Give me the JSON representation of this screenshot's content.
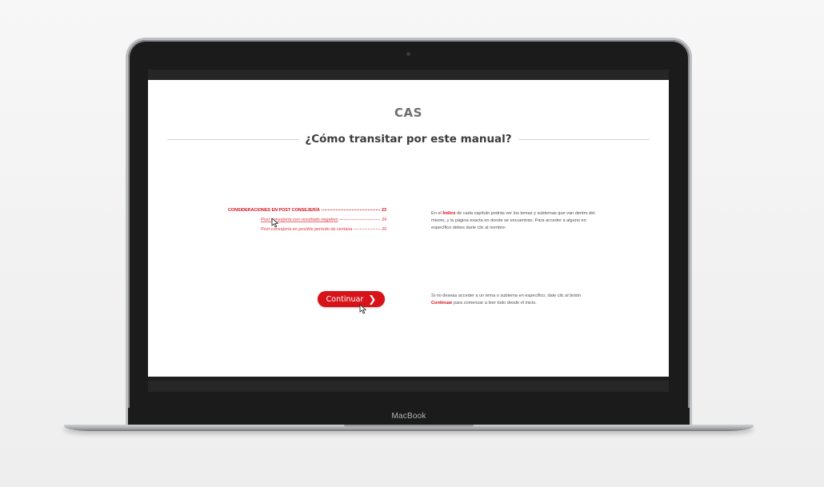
{
  "device": {
    "brand_label": "MacBook"
  },
  "page": {
    "brand": "CAS",
    "title": "¿Cómo transitar por este manual?"
  },
  "toc": {
    "main": {
      "label": "CONSIDERACIONES EN POST CONSEJERÍA",
      "page": "23"
    },
    "items": [
      {
        "label": "Post consejería con resultado negativo",
        "page": "24"
      },
      {
        "label": "Post consejería en posible periodo de ventana",
        "page": "25"
      }
    ]
  },
  "instructions": {
    "index": {
      "prefix": "En el ",
      "highlight": "Índice",
      "suffix": " de cada capítulo podrás ver los temas y subtemas que van dentro del mismo, y la página exacta en donde se encuentran. Para acceder a alguno en específico debes darle clic al nombre-"
    },
    "continue": {
      "prefix": "Si no deseas acceder a un tema o subtema en específico, dale clic al botón ",
      "highlight": "Continuar",
      "suffix": " para comenzar a leer todo desde el inicio."
    }
  },
  "button": {
    "continue_label": "Continuar"
  },
  "colors": {
    "accent": "#d5101a",
    "accent_light": "#ea6a72",
    "text": "#505050",
    "title": "#3c3c3c"
  },
  "icons": {
    "button_arrow": "chevron-right-icon",
    "cursor": "mouse-pointer-icon"
  }
}
